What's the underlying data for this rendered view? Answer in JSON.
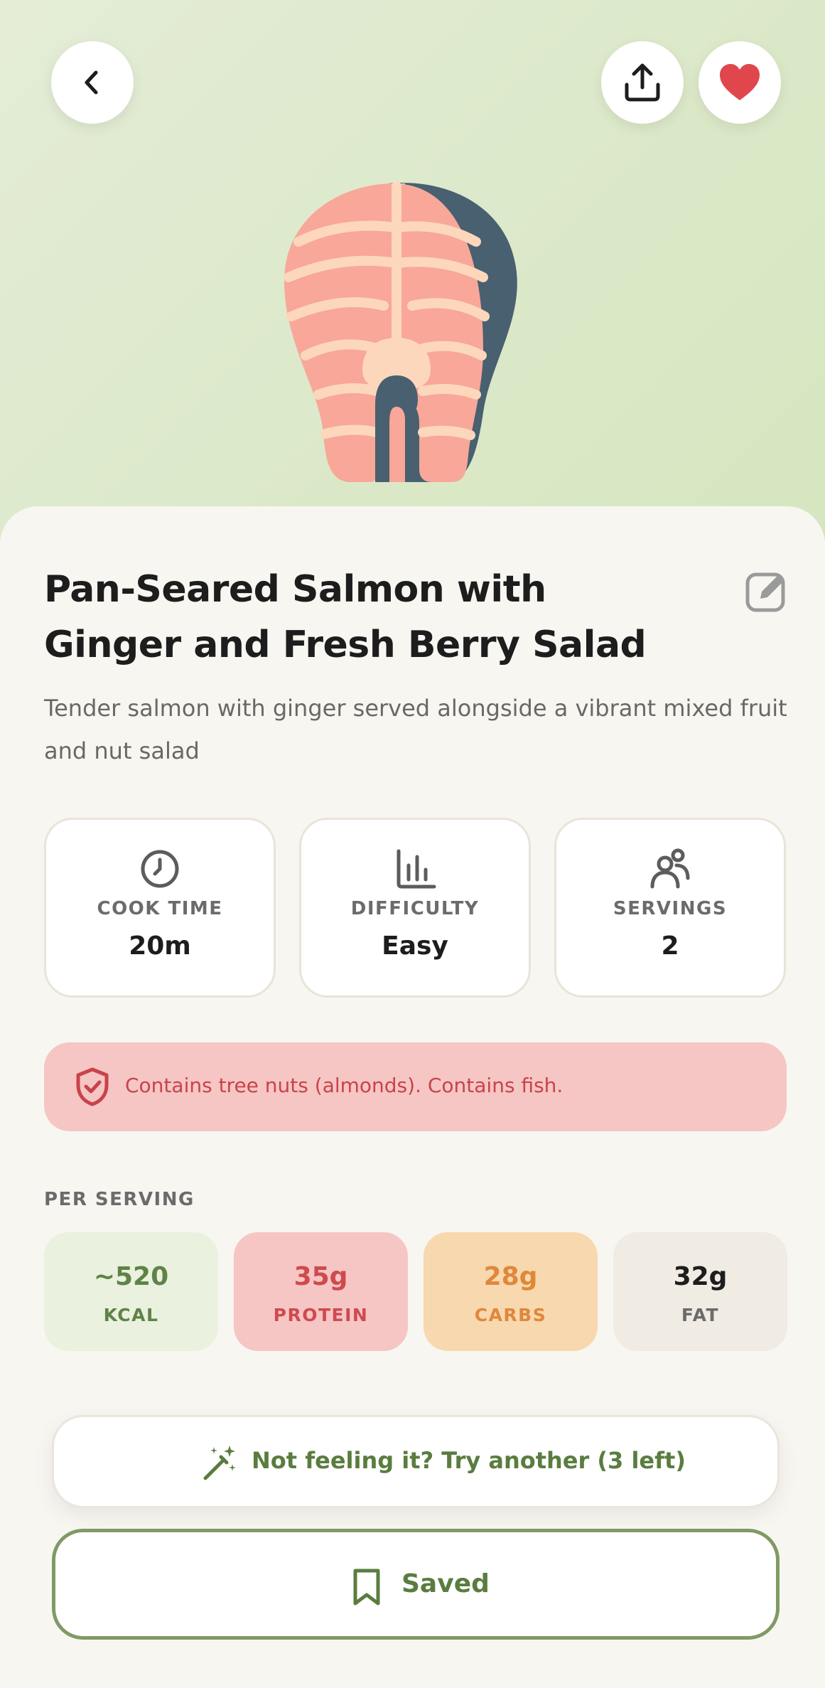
{
  "header": {
    "back_icon": "chevron-left-icon",
    "share_icon": "share-upload-icon",
    "favorite_icon": "heart-icon",
    "favorite_color": "#e0474c",
    "hero_illustration": "salmon-steak"
  },
  "recipe": {
    "title": "Pan-Seared Salmon with Ginger and Fresh Berry Salad",
    "description": "Tender salmon with ginger served alongside a vibrant mixed fruit and nut salad",
    "edit_icon": "edit-icon"
  },
  "stats": [
    {
      "icon": "clock-icon",
      "label": "COOK TIME",
      "value": "20m"
    },
    {
      "icon": "bar-chart-icon",
      "label": "DIFFICULTY",
      "value": "Easy"
    },
    {
      "icon": "people-icon",
      "label": "SERVINGS",
      "value": "2"
    }
  ],
  "allergy": {
    "icon": "shield-check-icon",
    "text": "Contains tree nuts (almonds). Contains fish."
  },
  "nutrition": {
    "heading": "PER SERVING",
    "macros": [
      {
        "value": "~520",
        "label": "KCAL",
        "color": "#5f8346"
      },
      {
        "value": "35g",
        "label": "PROTEIN",
        "color": "#cf4a4f"
      },
      {
        "value": "28g",
        "label": "CARBS",
        "color": "#e0883a"
      },
      {
        "value": "32g",
        "label": "FAT",
        "color": "#1d1d1d"
      }
    ]
  },
  "actions": {
    "try_another_label": "Not feeling it? Try another (3 left)",
    "try_another_icon": "magic-wand-icon",
    "saved_label": "Saved",
    "saved_icon": "bookmark-icon",
    "accent_color": "#5a7d3f"
  }
}
